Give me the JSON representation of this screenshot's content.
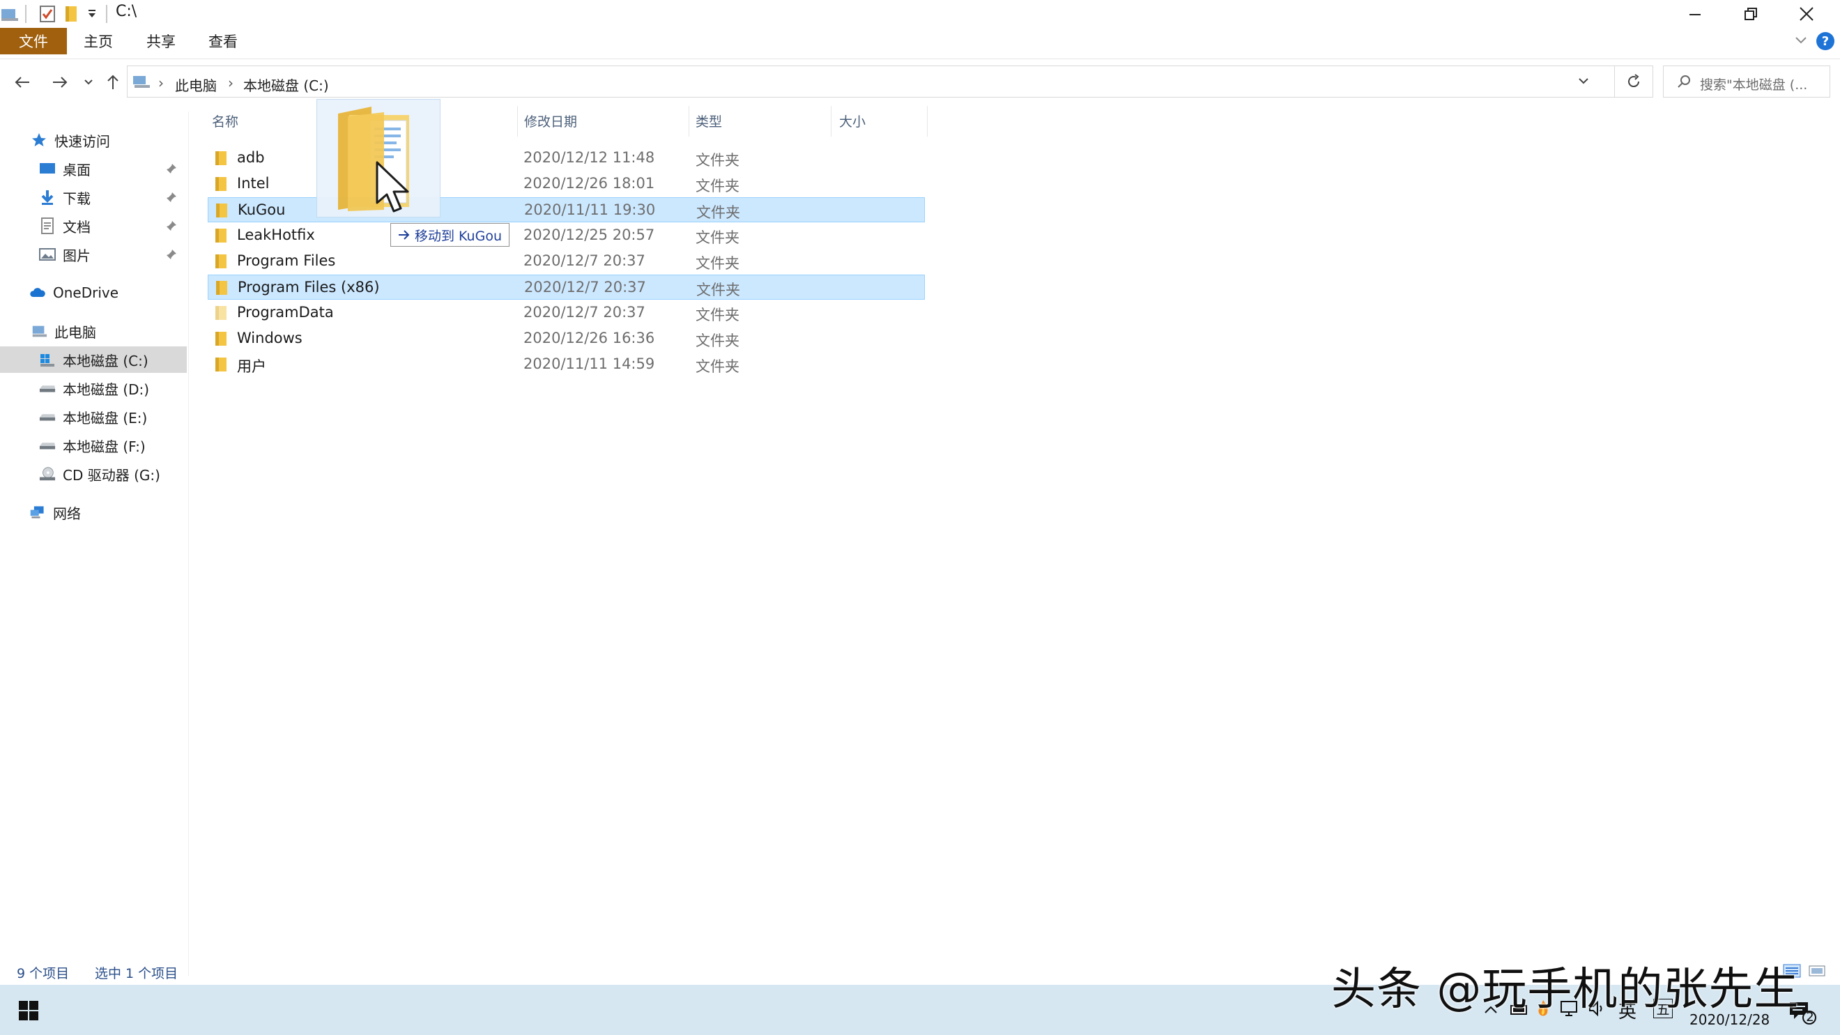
{
  "window": {
    "title": "C:\\"
  },
  "ribbon": {
    "tabs": [
      {
        "label": "文件"
      },
      {
        "label": "主页"
      },
      {
        "label": "共享"
      },
      {
        "label": "查看"
      }
    ],
    "help_label": "?"
  },
  "address": {
    "breadcrumb": [
      "此电脑",
      "本地磁盘 (C:)"
    ],
    "search_placeholder": "搜索\"本地磁盘 (..."
  },
  "sidebar": {
    "items": [
      {
        "label": "快速访问",
        "icon": "star-icon"
      },
      {
        "label": "桌面",
        "icon": "desktop-icon"
      },
      {
        "label": "下载",
        "icon": "download-icon"
      },
      {
        "label": "文档",
        "icon": "document-icon"
      },
      {
        "label": "图片",
        "icon": "picture-icon"
      },
      {
        "label": "OneDrive",
        "icon": "cloud-icon"
      },
      {
        "label": "此电脑",
        "icon": "computer-icon"
      },
      {
        "label": "本地磁盘 (C:)",
        "icon": "drive-icon"
      },
      {
        "label": "本地磁盘 (D:)",
        "icon": "drive-icon"
      },
      {
        "label": "本地磁盘 (E:)",
        "icon": "drive-icon"
      },
      {
        "label": "本地磁盘 (F:)",
        "icon": "drive-icon"
      },
      {
        "label": "CD 驱动器 (G:)",
        "icon": "cd-drive-icon"
      },
      {
        "label": "网络",
        "icon": "network-icon"
      }
    ]
  },
  "columns": {
    "name": "名称",
    "date": "修改日期",
    "type": "类型",
    "size": "大小"
  },
  "files": [
    {
      "name": "adb",
      "date": "2020/12/12 11:48",
      "type": "文件夹"
    },
    {
      "name": "Intel",
      "date": "2020/12/26 18:01",
      "type": "文件夹"
    },
    {
      "name": "KuGou",
      "date": "2020/11/11 19:30",
      "type": "文件夹"
    },
    {
      "name": "LeakHotfix",
      "date": "2020/12/25 20:57",
      "type": "文件夹"
    },
    {
      "name": "Program Files",
      "date": "2020/12/7 20:37",
      "type": "文件夹"
    },
    {
      "name": "Program Files (x86)",
      "date": "2020/12/7 20:37",
      "type": "文件夹"
    },
    {
      "name": "ProgramData",
      "date": "2020/12/7 20:37",
      "type": "文件夹"
    },
    {
      "name": "Windows",
      "date": "2020/12/26 16:36",
      "type": "文件夹"
    },
    {
      "name": "用户",
      "date": "2020/11/11 14:59",
      "type": "文件夹"
    }
  ],
  "drag": {
    "tooltip": "移动到 KuGou"
  },
  "status": {
    "item_count": "9 个项目",
    "selected_count": "选中 1 个项目"
  },
  "taskbar": {
    "ime_lang": "英",
    "ime_mode": "五",
    "date": "2020/12/28",
    "notification_count": "2"
  },
  "watermark": "头条 @玩手机的张先生",
  "colors": {
    "file_tab": "#a0600e",
    "selection": "#cce8ff",
    "selection_border": "#99d1ff",
    "taskbar": "#d6e7f2",
    "folder": "#f4c542"
  }
}
